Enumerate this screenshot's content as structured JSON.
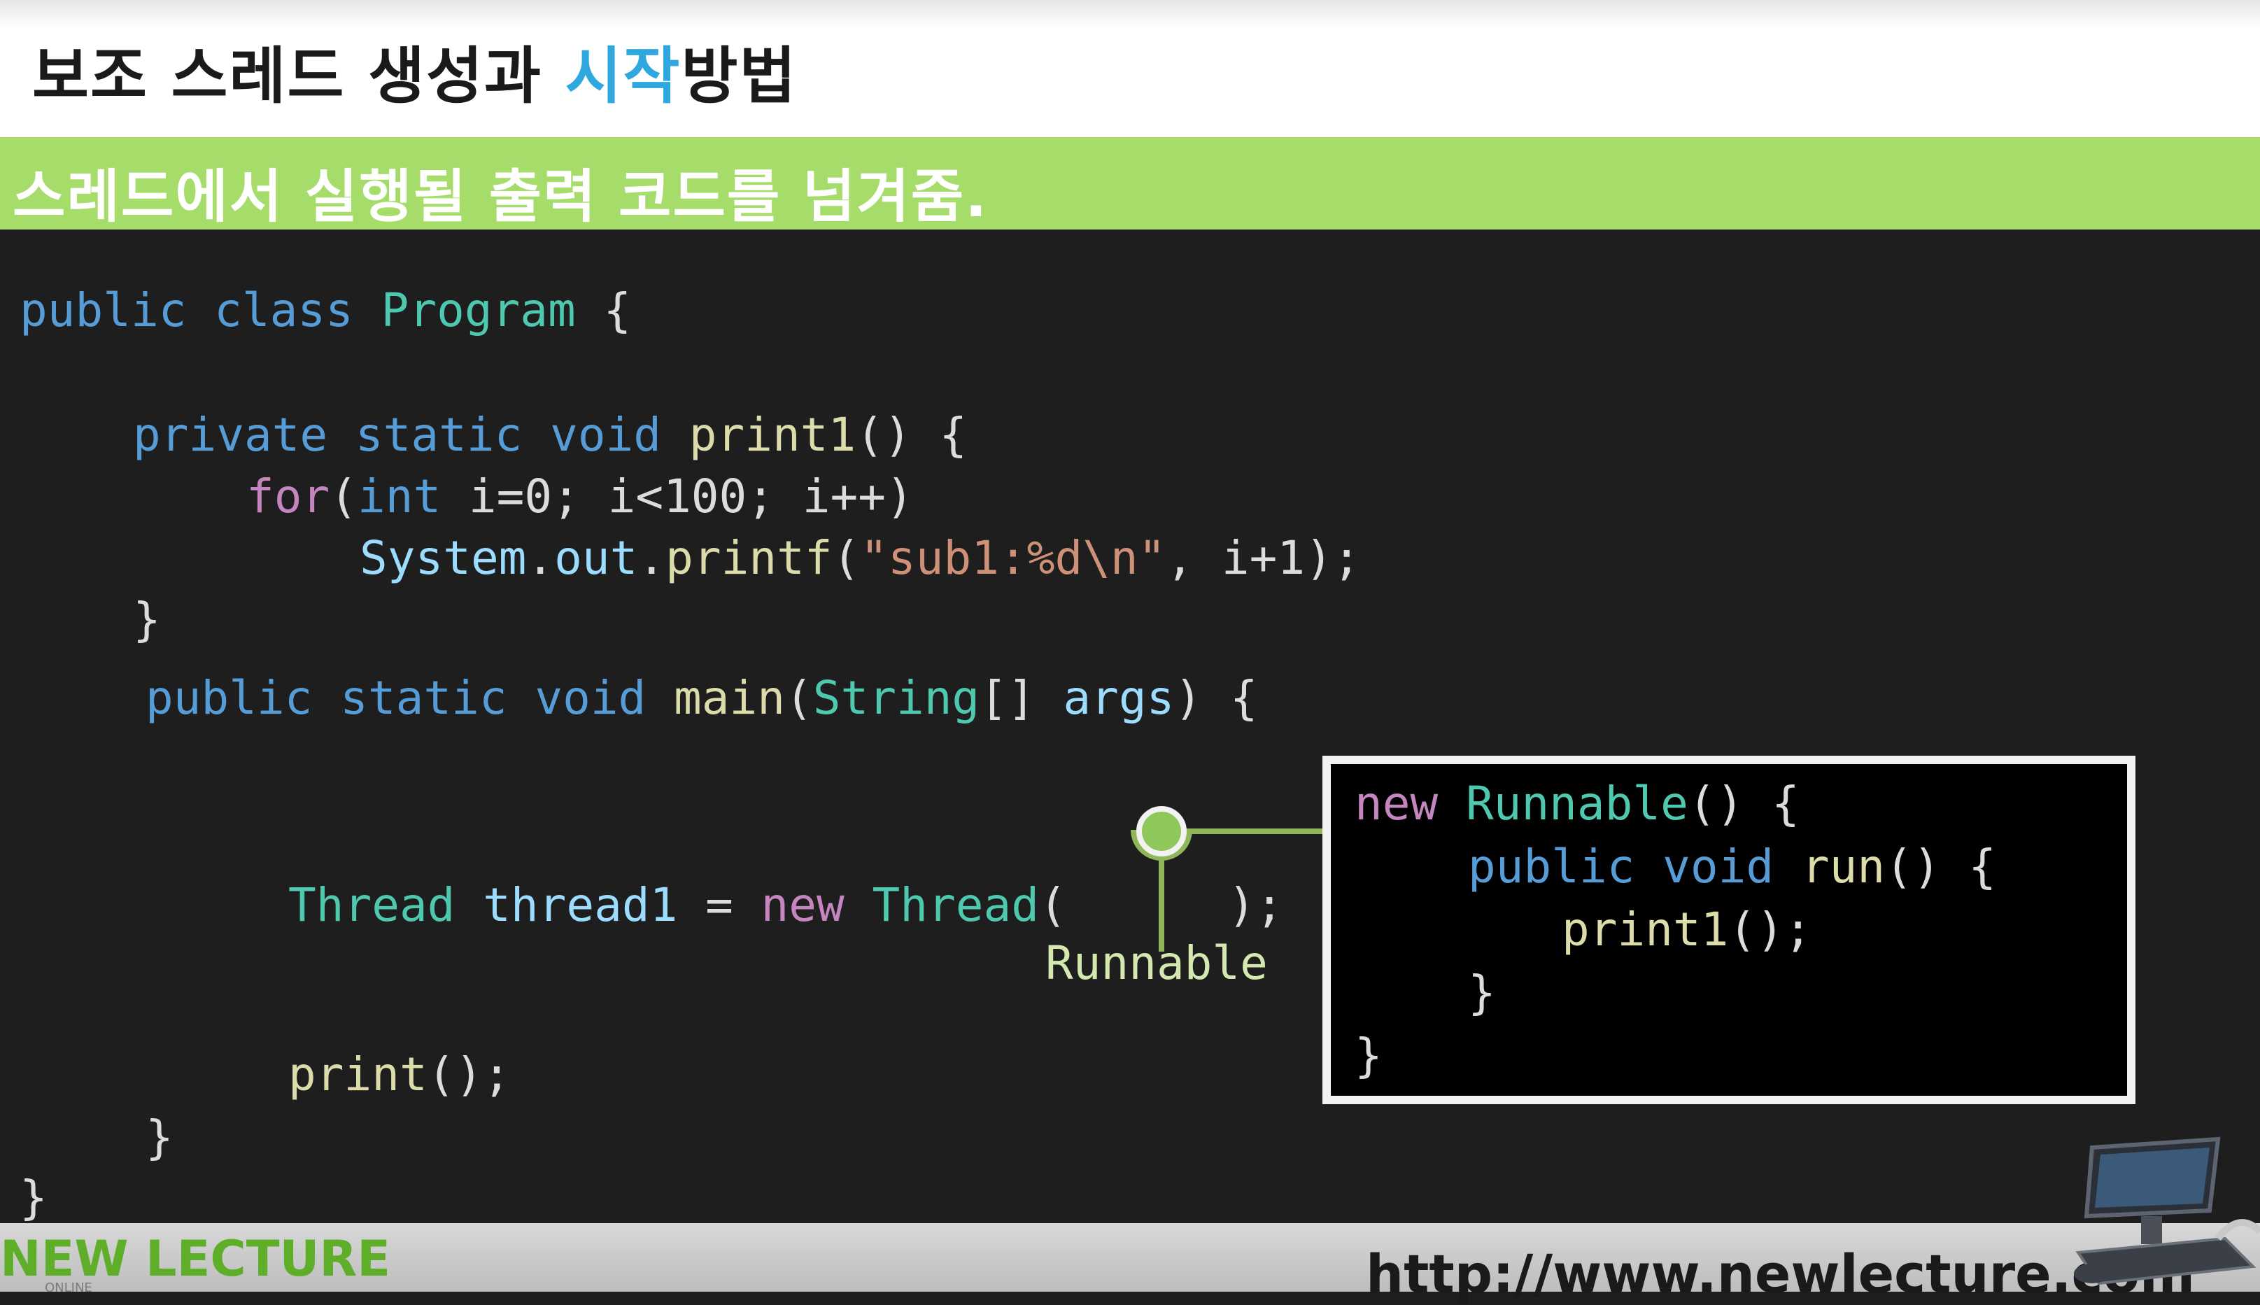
{
  "slide": {
    "title_part1": "보조 스레드 생성과 ",
    "title_accent": "시작",
    "title_part2": "방법",
    "subtitle": "스레드에서 실행될 출력 코드를 넘겨줌.",
    "accent_color": "#2fa8e0",
    "banner_color": "#a6dc6a"
  },
  "code": {
    "l1": {
      "kw_public": "public",
      "kw_class": "class",
      "name": "Program",
      "brace": "{"
    },
    "l2": {
      "kw_private": "private",
      "kw_static": "static",
      "kw_void": "void",
      "fn": "print1",
      "rest": "() {"
    },
    "l3": {
      "kw_for": "for",
      "p1": "(",
      "kw_int": "int",
      "p2": " i=0; i<100; i++)"
    },
    "l4": {
      "sys": "System",
      "dot1": ".",
      "out": "out",
      "dot2": ".",
      "fn": "printf",
      "p1": "(",
      "str": "\"sub1:%d\\n\"",
      "p2": ", i+1);"
    },
    "l5": {
      "brace": "}"
    },
    "l6": {
      "kw_public": "public",
      "kw_static": "static",
      "kw_void": "void",
      "fn": "main",
      "p1": "(",
      "ty": "String",
      "p2": "[] ",
      "args": "args",
      "p3": ") {"
    },
    "l7": {
      "ty1": "Thread",
      "var": "thread1",
      "eq": " = ",
      "kw_new": "new",
      "ty2": "Thread",
      "p1": "(",
      "p2": ");"
    },
    "l8": {
      "fn": "print",
      "p1": "();"
    },
    "l9": {
      "brace": "}"
    },
    "l10": {
      "brace": "}"
    }
  },
  "annotation": {
    "label": "Runnable",
    "popup": {
      "p1": {
        "kw_new": "new",
        "ty": "Runnable",
        "rest": "() {"
      },
      "p2": {
        "kw_public": "public",
        "kw_void": "void",
        "fn": "run",
        "rest": "() {"
      },
      "p3": {
        "fn": "print1",
        "rest": "();"
      },
      "p4": {
        "brace": "}"
      },
      "p5": {
        "brace": "}"
      }
    }
  },
  "footer": {
    "logo_n": "N",
    "logo_text": "EW LECTURE",
    "logo_sub": "ONLINE",
    "url": "http://www.newlecture.com",
    "icon": "computer-icon"
  }
}
